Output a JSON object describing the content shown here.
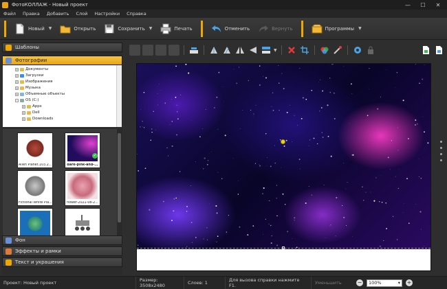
{
  "window": {
    "title": "ФотоКОЛЛАЖ - Новый проект",
    "controls": [
      "—",
      "☐",
      "✕"
    ]
  },
  "menu": [
    "Файл",
    "Правка",
    "Добавить",
    "Слой",
    "Настройки",
    "Справка"
  ],
  "toolbar": {
    "new": "Новый",
    "open": "Открыть",
    "save": "Сохранить",
    "print": "Печать",
    "undo": "Отменить",
    "redo": "Вернуть",
    "programs": "Программы"
  },
  "left_panel": {
    "templates": "Шаблоны",
    "photos": "Фотографии",
    "background": "Фон",
    "effects": "Эффекты и рамки",
    "text": "Текст и украшения"
  },
  "tree": [
    {
      "label": "Документы",
      "level": 1,
      "exp": "+"
    },
    {
      "label": "Загрузки",
      "level": 1,
      "exp": "+"
    },
    {
      "label": "Изображения",
      "level": 1,
      "exp": "+"
    },
    {
      "label": "Музыка",
      "level": 1,
      "exp": "+"
    },
    {
      "label": "Объемные объекты",
      "level": 1,
      "exp": "+"
    },
    {
      "label": "OS (C:)",
      "level": 1,
      "exp": "-"
    },
    {
      "label": "Apps",
      "level": 2,
      "exp": "+"
    },
    {
      "label": "Dell",
      "level": 2,
      "exp": "+"
    },
    {
      "label": "Downloads",
      "level": 2,
      "exp": "+"
    }
  ],
  "thumbnails": [
    {
      "caption": "Alien Planet.103.2...",
      "bold": false,
      "kind": "planet-red"
    },
    {
      "caption": "dark-pink-and-...",
      "bold": true,
      "kind": "space",
      "checked": true
    },
    {
      "caption": "Fictional White Pla...",
      "bold": false,
      "kind": "planet-white"
    },
    {
      "caption": "flower-2021-08-2...",
      "bold": false,
      "kind": "flower"
    },
    {
      "caption": "",
      "bold": false,
      "kind": "planet-blue"
    },
    {
      "caption": "",
      "bold": false,
      "kind": "rover"
    }
  ],
  "status": {
    "project": "Проект: Новый проект",
    "size": "Размер: 3508x2480",
    "layers": "Слоев: 1",
    "help": "Для вызова справки нажмите F1.",
    "reduce": "Уменьшить",
    "zoom": "100%"
  },
  "colors": {
    "accent": "#f0a800"
  }
}
